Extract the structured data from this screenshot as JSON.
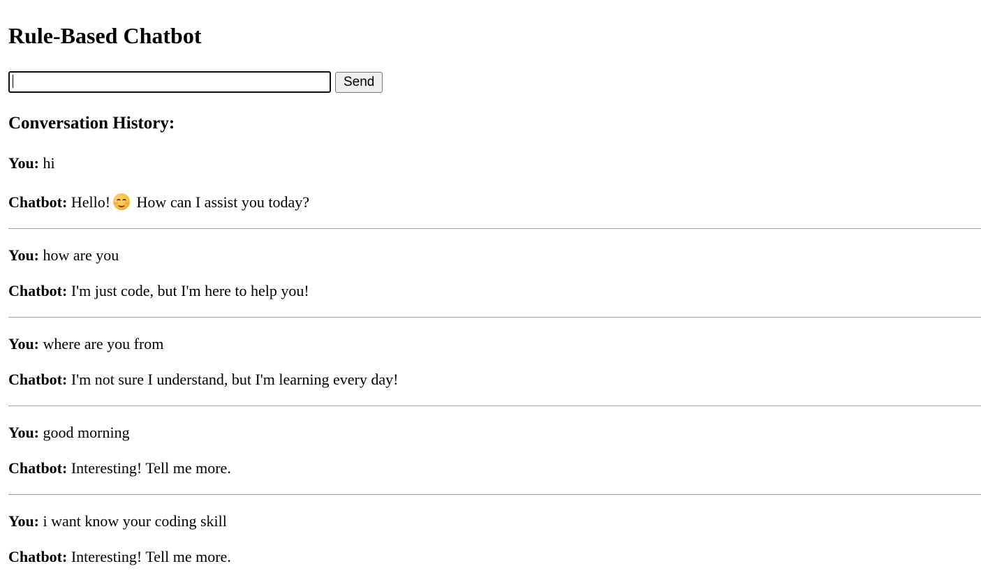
{
  "page": {
    "title": "Rule-Based Chatbot"
  },
  "composer": {
    "input_value": "",
    "input_placeholder": "",
    "send_label": "Send"
  },
  "history": {
    "heading": "Conversation History:",
    "exchanges": [
      {
        "user_label": "You:",
        "user_text": "hi",
        "bot_label": "Chatbot:",
        "bot_text_before": "Hello!",
        "bot_emoji": "smiling-face-icon",
        "bot_text_after": "How can I assist you today?"
      },
      {
        "user_label": "You:",
        "user_text": "how are you",
        "bot_label": "Chatbot:",
        "bot_text": "I'm just code, but I'm here to help you!"
      },
      {
        "user_label": "You:",
        "user_text": "where are you from",
        "bot_label": "Chatbot:",
        "bot_text": "I'm not sure I understand, but I'm learning every day!"
      },
      {
        "user_label": "You:",
        "user_text": "good morning",
        "bot_label": "Chatbot:",
        "bot_text": "Interesting! Tell me more."
      },
      {
        "user_label": "You:",
        "user_text": "i want know your coding skill",
        "bot_label": "Chatbot:",
        "bot_text": "Interesting! Tell me more."
      }
    ]
  }
}
